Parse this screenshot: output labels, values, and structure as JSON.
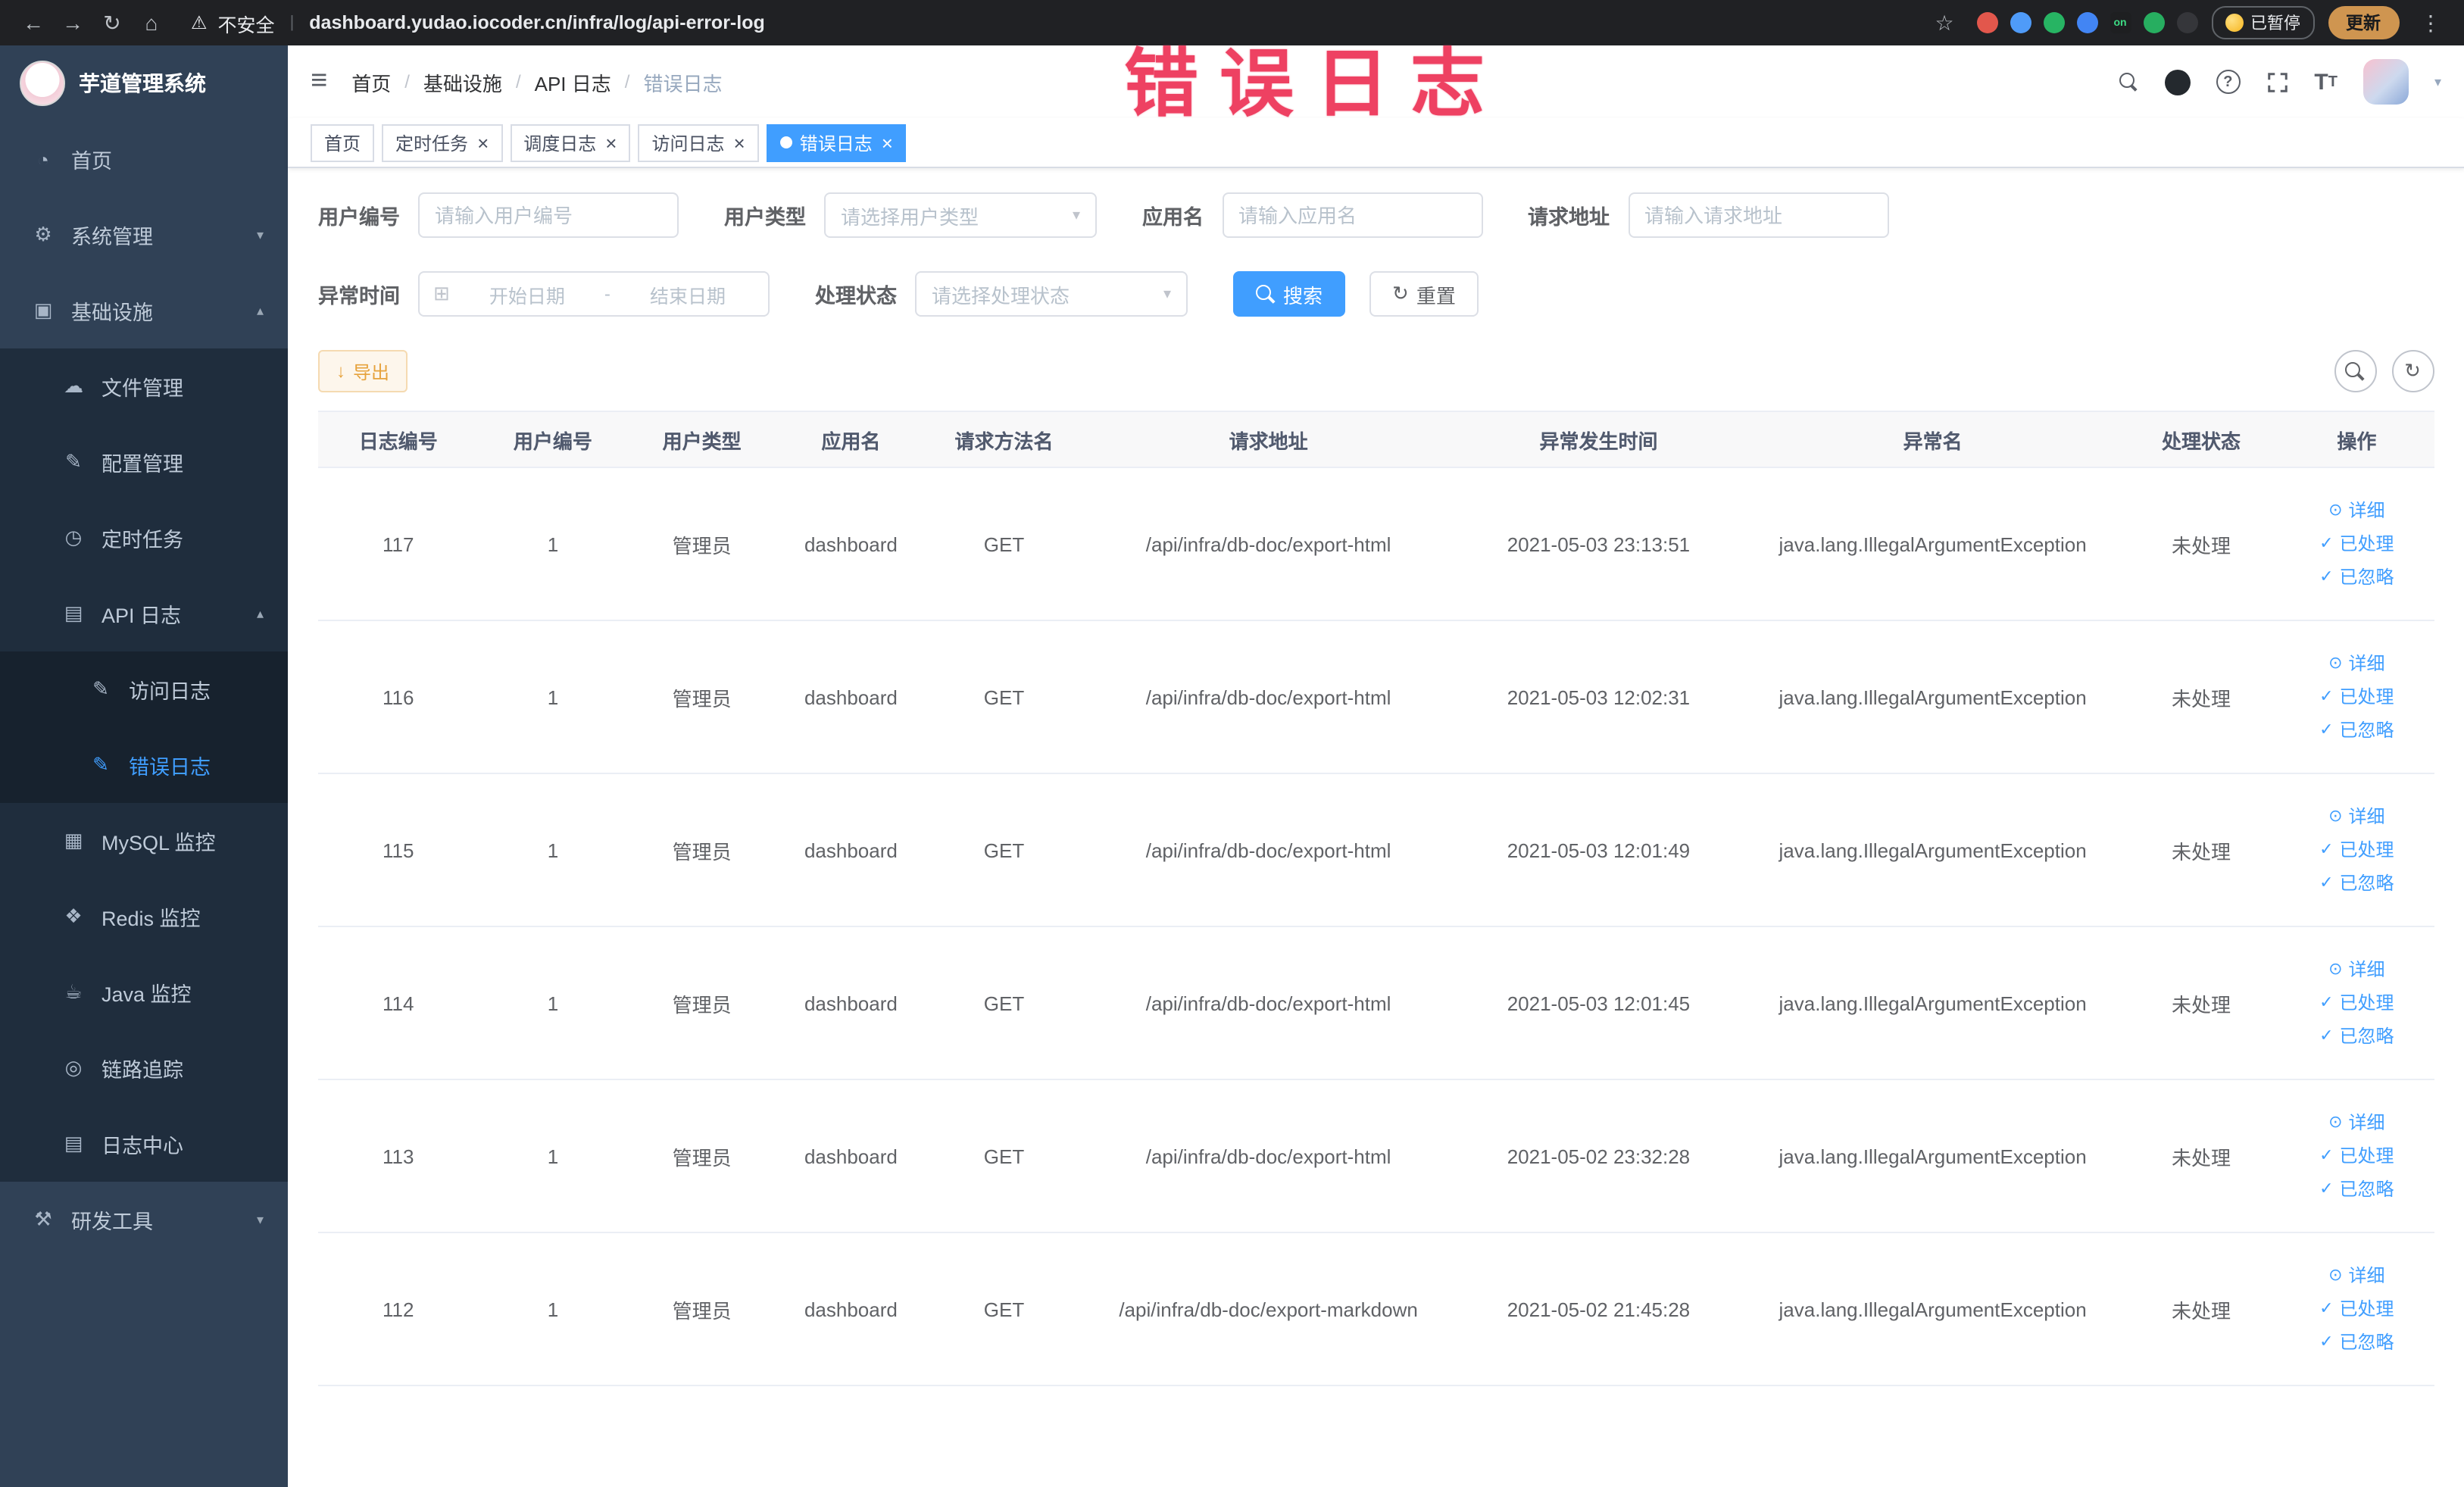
{
  "watermark": "错误日志",
  "browser": {
    "warning": "不安全",
    "url": "dashboard.yudao.iocoder.cn/infra/log/api-error-log",
    "paused_badge": "已暂停",
    "update_button": "更新",
    "extensions": [
      {
        "name": "extension-red-icon",
        "color": "#e2574c",
        "label": ""
      },
      {
        "name": "extension-blue-drop-icon",
        "color": "#4f9bf8",
        "label": ""
      },
      {
        "name": "extension-green-icon",
        "color": "#27b463",
        "label": ""
      },
      {
        "name": "extension-grid-icon",
        "color": "#4285f4",
        "label": ""
      },
      {
        "name": "extension-on-icon",
        "color": "#1e1f21",
        "label": "on",
        "label_color": "#3ddc84"
      },
      {
        "name": "extension-leaf-icon",
        "color": "#27ae60",
        "label": ""
      },
      {
        "name": "extension-dark-icon",
        "color": "#35363a",
        "label": ""
      }
    ]
  },
  "sidebar": {
    "logo_title": "芋道管理系统",
    "items": [
      {
        "id": "home",
        "label": "首页",
        "icon": "dashboard-icon",
        "glyph": "◔",
        "level": 1
      },
      {
        "id": "system",
        "label": "系统管理",
        "icon": "gear-icon",
        "glyph": "⚙",
        "level": 1,
        "chevron": "down"
      },
      {
        "id": "infra",
        "label": "基础设施",
        "icon": "monitor-icon",
        "glyph": "▣",
        "level": 1,
        "chevron": "up"
      },
      {
        "id": "file",
        "label": "文件管理",
        "icon": "cloud-icon",
        "glyph": "☁",
        "level": 2
      },
      {
        "id": "config",
        "label": "配置管理",
        "icon": "edit-icon",
        "glyph": "✎",
        "level": 2
      },
      {
        "id": "job",
        "label": "定时任务",
        "icon": "schedule-icon",
        "glyph": "◷",
        "level": 2
      },
      {
        "id": "api-log",
        "label": "API 日志",
        "icon": "log-icon",
        "glyph": "▤",
        "level": 2,
        "chevron": "up"
      },
      {
        "id": "access-log",
        "label": "访问日志",
        "icon": "edit-doc-icon",
        "glyph": "✎",
        "level": 3
      },
      {
        "id": "error-log",
        "label": "错误日志",
        "icon": "edit-doc-icon",
        "glyph": "✎",
        "level": 3,
        "active": true
      },
      {
        "id": "mysql",
        "label": "MySQL 监控",
        "icon": "grid-icon",
        "glyph": "▦",
        "level": 2
      },
      {
        "id": "redis",
        "label": "Redis 监控",
        "icon": "coins-icon",
        "glyph": "❖",
        "level": 2
      },
      {
        "id": "java",
        "label": "Java 监控",
        "icon": "coffee-icon",
        "glyph": "☕",
        "level": 2
      },
      {
        "id": "tracer",
        "label": "链路追踪",
        "icon": "target-icon",
        "glyph": "◎",
        "level": 2
      },
      {
        "id": "log-center",
        "label": "日志中心",
        "icon": "doc-icon",
        "glyph": "▤",
        "level": 2
      },
      {
        "id": "dev-tools",
        "label": "研发工具",
        "icon": "tools-icon",
        "glyph": "⚒",
        "level": 1,
        "chevron": "down"
      }
    ]
  },
  "breadcrumb": [
    "首页",
    "基础设施",
    "API 日志",
    "错误日志"
  ],
  "tabs": [
    {
      "id": "home",
      "label": "首页",
      "closable": false,
      "active": false
    },
    {
      "id": "job",
      "label": "定时任务",
      "closable": true,
      "active": false
    },
    {
      "id": "job-log",
      "label": "调度日志",
      "closable": true,
      "active": false
    },
    {
      "id": "access-log",
      "label": "访问日志",
      "closable": true,
      "active": false
    },
    {
      "id": "error-log",
      "label": "错误日志",
      "closable": true,
      "active": true
    }
  ],
  "filters": {
    "user_id": {
      "label": "用户编号",
      "placeholder": "请输入用户编号"
    },
    "user_type": {
      "label": "用户类型",
      "placeholder": "请选择用户类型"
    },
    "app_name": {
      "label": "应用名",
      "placeholder": "请输入应用名"
    },
    "request_url": {
      "label": "请求地址",
      "placeholder": "请输入请求地址"
    },
    "exception_time": {
      "label": "异常时间",
      "start_placeholder": "开始日期",
      "separator": "-",
      "end_placeholder": "结束日期"
    },
    "process_status": {
      "label": "处理状态",
      "placeholder": "请选择处理状态"
    },
    "search_button": "搜索",
    "reset_button": "重置"
  },
  "toolbar": {
    "export_label": "导出",
    "export_icon_glyph": "↓"
  },
  "table": {
    "columns": [
      "日志编号",
      "用户编号",
      "用户类型",
      "应用名",
      "请求方法名",
      "请求地址",
      "异常发生时间",
      "异常名",
      "处理状态",
      "操作"
    ],
    "actions": [
      {
        "id": "detail",
        "label": "详细",
        "icon": "eye-icon",
        "glyph": "⊙"
      },
      {
        "id": "processed",
        "label": "已处理",
        "icon": "check-icon",
        "glyph": "✓"
      },
      {
        "id": "ignore",
        "label": "已忽略",
        "icon": "check-icon",
        "glyph": "✓"
      }
    ],
    "rows": [
      {
        "id": "117",
        "user_id": "1",
        "user_type": "管理员",
        "app": "dashboard",
        "method": "GET",
        "url": "/api/infra/db-doc/export-html",
        "time": "2021-05-03 23:13:51",
        "exception": "java.lang.IllegalArgumentException",
        "status": "未处理"
      },
      {
        "id": "116",
        "user_id": "1",
        "user_type": "管理员",
        "app": "dashboard",
        "method": "GET",
        "url": "/api/infra/db-doc/export-html",
        "time": "2021-05-03 12:02:31",
        "exception": "java.lang.IllegalArgumentException",
        "status": "未处理"
      },
      {
        "id": "115",
        "user_id": "1",
        "user_type": "管理员",
        "app": "dashboard",
        "method": "GET",
        "url": "/api/infra/db-doc/export-html",
        "time": "2021-05-03 12:01:49",
        "exception": "java.lang.IllegalArgumentException",
        "status": "未处理"
      },
      {
        "id": "114",
        "user_id": "1",
        "user_type": "管理员",
        "app": "dashboard",
        "method": "GET",
        "url": "/api/infra/db-doc/export-html",
        "time": "2021-05-03 12:01:45",
        "exception": "java.lang.IllegalArgumentException",
        "status": "未处理"
      },
      {
        "id": "113",
        "user_id": "1",
        "user_type": "管理员",
        "app": "dashboard",
        "method": "GET",
        "url": "/api/infra/db-doc/export-html",
        "time": "2021-05-02 23:32:28",
        "exception": "java.lang.IllegalArgumentException",
        "status": "未处理"
      },
      {
        "id": "112",
        "user_id": "1",
        "user_type": "管理员",
        "app": "dashboard",
        "method": "GET",
        "url": "/api/infra/db-doc/export-markdown",
        "time": "2021-05-02 21:45:28",
        "exception": "java.lang.IllegalArgumentException",
        "status": "未处理"
      }
    ]
  }
}
